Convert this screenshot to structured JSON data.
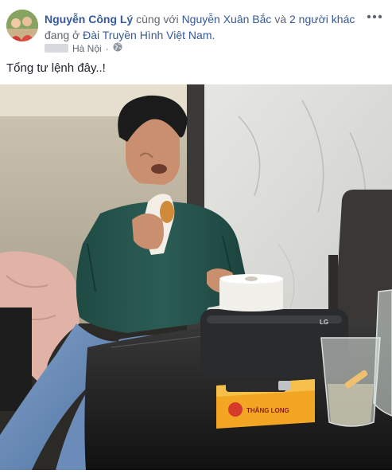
{
  "post": {
    "author": "Nguyễn Công Lý",
    "with_text": "cùng với",
    "tagged_friend": "Nguyễn Xuân Bắc",
    "and_text": "và",
    "others": "2 người khác",
    "at_text": "đang ở",
    "place": "Đài Truyền Hình Việt Nam.",
    "location": "Hà Nội",
    "separator": "·",
    "caption": "Tổng tư lệnh đây..!"
  },
  "photo": {
    "speaker_brand": "LG",
    "cigarette_brand": "THĂNG LONG"
  },
  "icons": {
    "privacy": "globe-icon",
    "menu": "more-options-icon"
  }
}
